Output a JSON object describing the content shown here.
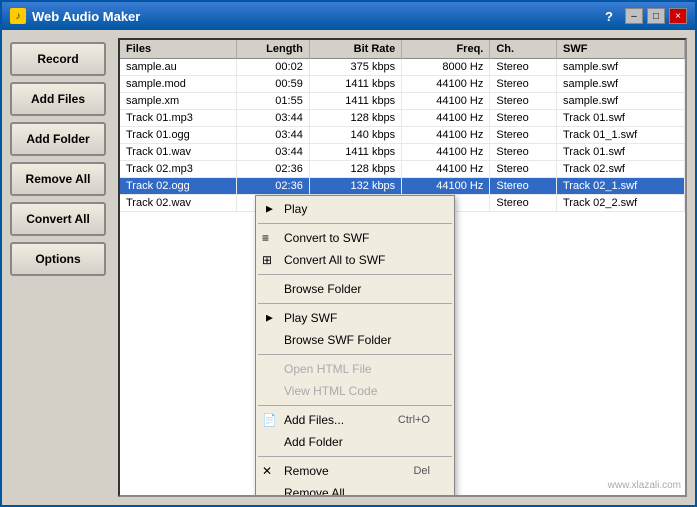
{
  "window": {
    "title": "Web Audio Maker",
    "help_btn": "?",
    "minimize_btn": "–",
    "close_btn": "×"
  },
  "sidebar": {
    "buttons": [
      {
        "label": "Record",
        "name": "record-button"
      },
      {
        "label": "Add Files",
        "name": "add-files-button"
      },
      {
        "label": "Add Folder",
        "name": "add-folder-button"
      },
      {
        "label": "Remove All",
        "name": "remove-all-button"
      },
      {
        "label": "Convert All",
        "name": "convert-all-button"
      },
      {
        "label": "Options",
        "name": "options-button"
      }
    ]
  },
  "table": {
    "columns": [
      "Files",
      "Length",
      "Bit Rate",
      "Freq.",
      "Ch.",
      "SWF"
    ],
    "rows": [
      {
        "file": "sample.au",
        "length": "00:02",
        "bitrate": "375 kbps",
        "freq": "8000 Hz",
        "ch": "Stereo",
        "swf": "sample.swf",
        "selected": false
      },
      {
        "file": "sample.mod",
        "length": "00:59",
        "bitrate": "1411 kbps",
        "freq": "44100 Hz",
        "ch": "Stereo",
        "swf": "sample.swf",
        "selected": false
      },
      {
        "file": "sample.xm",
        "length": "01:55",
        "bitrate": "1411 kbps",
        "freq": "44100 Hz",
        "ch": "Stereo",
        "swf": "sample.swf",
        "selected": false
      },
      {
        "file": "Track 01.mp3",
        "length": "03:44",
        "bitrate": "128 kbps",
        "freq": "44100 Hz",
        "ch": "Stereo",
        "swf": "Track 01.swf",
        "selected": false
      },
      {
        "file": "Track 01.ogg",
        "length": "03:44",
        "bitrate": "140 kbps",
        "freq": "44100 Hz",
        "ch": "Stereo",
        "swf": "Track 01_1.swf",
        "selected": false
      },
      {
        "file": "Track 01.wav",
        "length": "03:44",
        "bitrate": "1411 kbps",
        "freq": "44100 Hz",
        "ch": "Stereo",
        "swf": "Track 01.swf",
        "selected": false
      },
      {
        "file": "Track 02.mp3",
        "length": "02:36",
        "bitrate": "128 kbps",
        "freq": "44100 Hz",
        "ch": "Stereo",
        "swf": "Track 02.swf",
        "selected": false
      },
      {
        "file": "Track 02.ogg",
        "length": "02:36",
        "bitrate": "132 kbps",
        "freq": "44100 Hz",
        "ch": "Stereo",
        "swf": "Track 02_1.swf",
        "selected": true
      },
      {
        "file": "Track 02.wav",
        "length": "",
        "bitrate": "",
        "freq": "",
        "ch": "Stereo",
        "swf": "Track 02_2.swf",
        "selected": false
      }
    ]
  },
  "context_menu": {
    "items": [
      {
        "type": "item",
        "label": "Play",
        "icon": "▶",
        "arrow": true,
        "shortcut": "",
        "disabled": false,
        "name": "ctx-play"
      },
      {
        "type": "divider"
      },
      {
        "type": "item",
        "label": "Convert to SWF",
        "icon": "≡",
        "arrow": false,
        "shortcut": "",
        "disabled": false,
        "name": "ctx-convert-swf"
      },
      {
        "type": "item",
        "label": "Convert All to SWF",
        "icon": "⊞",
        "arrow": false,
        "shortcut": "",
        "disabled": false,
        "name": "ctx-convert-all-swf"
      },
      {
        "type": "divider"
      },
      {
        "type": "item",
        "label": "Browse Folder",
        "icon": "",
        "arrow": false,
        "shortcut": "",
        "disabled": false,
        "name": "ctx-browse-folder"
      },
      {
        "type": "divider"
      },
      {
        "type": "item",
        "label": "Play SWF",
        "icon": "",
        "arrow": true,
        "shortcut": "",
        "disabled": false,
        "name": "ctx-play-swf"
      },
      {
        "type": "item",
        "label": "Browse SWF Folder",
        "icon": "",
        "arrow": false,
        "shortcut": "",
        "disabled": false,
        "name": "ctx-browse-swf-folder"
      },
      {
        "type": "divider"
      },
      {
        "type": "item",
        "label": "Open HTML File",
        "icon": "",
        "arrow": false,
        "shortcut": "",
        "disabled": true,
        "name": "ctx-open-html"
      },
      {
        "type": "item",
        "label": "View HTML Code",
        "icon": "",
        "arrow": false,
        "shortcut": "",
        "disabled": true,
        "name": "ctx-view-html"
      },
      {
        "type": "divider"
      },
      {
        "type": "item",
        "label": "Add Files...",
        "icon": "📄",
        "arrow": false,
        "shortcut": "Ctrl+O",
        "disabled": false,
        "name": "ctx-add-files"
      },
      {
        "type": "item",
        "label": "Add Folder",
        "icon": "",
        "arrow": false,
        "shortcut": "",
        "disabled": false,
        "name": "ctx-add-folder"
      },
      {
        "type": "divider"
      },
      {
        "type": "item",
        "label": "Remove",
        "icon": "✕",
        "arrow": false,
        "shortcut": "Del",
        "disabled": false,
        "name": "ctx-remove"
      },
      {
        "type": "item",
        "label": "Remove All",
        "icon": "",
        "arrow": false,
        "shortcut": "",
        "disabled": false,
        "name": "ctx-remove-all"
      }
    ]
  },
  "watermark": "www.xlazali.com"
}
